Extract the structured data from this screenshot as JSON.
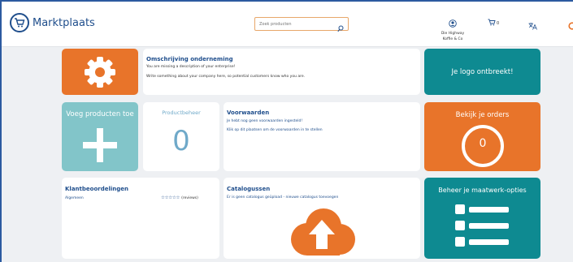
{
  "header": {
    "logo_text": "Marktplaats",
    "search_placeholder": "Zoek producten",
    "account_name_line1": "Die Highway",
    "account_name_line2": "Koffie & Co",
    "cart_count": "0"
  },
  "cards": {
    "settings": {
      "icon": "gear-icon"
    },
    "company": {
      "title": "Omschrijving onderneming",
      "line1": "You are missing a description of your enterprise!",
      "line2": "Write something about your company here, so potential customers know who you are."
    },
    "logo": {
      "title": "Je logo ontbreekt!"
    },
    "add_products": {
      "title": "Voeg producten toe"
    },
    "product_management": {
      "title": "Productbeheer",
      "count": "0"
    },
    "terms": {
      "title": "Voorwaarden",
      "line1": "Je hebt nog geen voorwaarden ingesteld!",
      "line2": "Klik op dit plaatsen om de voorwaarden in te stellen"
    },
    "orders": {
      "title": "Bekijk je orders",
      "count": "0"
    },
    "reviews": {
      "title": "Klantbeoordelingen",
      "label": "Algemeen",
      "stars": "☆☆☆☆☆",
      "count_label": "(reviews)"
    },
    "catalogs": {
      "title": "Catalogussen",
      "line1": "Er is geen catalogus geüpload - nieuwe catalogus toevoegen"
    },
    "custom": {
      "title": "Beheer je maatwerk-opties"
    }
  },
  "colors": {
    "orange": "#e8742a",
    "teal": "#0e8a91",
    "light_teal": "#82c5c9",
    "brand_blue": "#1f4e8c"
  }
}
